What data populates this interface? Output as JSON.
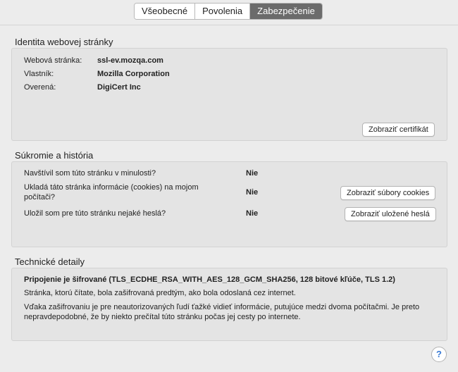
{
  "tabs": [
    {
      "label": "Všeobecné",
      "active": false
    },
    {
      "label": "Povolenia",
      "active": false
    },
    {
      "label": "Zabezpečenie",
      "active": true
    }
  ],
  "identity": {
    "title": "Identita webovej stránky",
    "website_label": "Webová stránka:",
    "website_value": "ssl-ev.mozqa.com",
    "owner_label": "Vlastník:",
    "owner_value": "Mozilla Corporation",
    "verified_label": "Overená:",
    "verified_value": "DigiCert Inc",
    "view_certificate_label": "Zobraziť certifikát"
  },
  "privacy": {
    "title": "Súkromie a história",
    "visited_question": "Navštívil som túto stránku v minulosti?",
    "visited_answer": "Nie",
    "cookies_question_line1": "Ukladá táto stránka informácie (cookies) na mojom",
    "cookies_question_line2": "počítači?",
    "cookies_answer": "Nie",
    "view_cookies_label": "Zobraziť súbory cookies",
    "passwords_question": "Uložil som pre túto stránku nejaké heslá?",
    "passwords_answer": "Nie",
    "view_passwords_label": "Zobraziť uložené heslá"
  },
  "technical": {
    "title": "Technické detaily",
    "connection_line": "Pripojenie je šifrované (TLS_ECDHE_RSA_WITH_AES_128_GCM_SHA256, 128 bitové kľúče, TLS 1.2)",
    "line2": "Stránka, ktorú čítate, bola zašifrovaná predtým, ako bola odoslaná cez internet.",
    "line3a": "Vďaka zašifrovaniu je pre neautorizovaných ľudí ťažké vidieť informácie, putujúce medzi dvoma počítačmi. Je preto",
    "line3b": "nepravdepodobné, že by niekto prečítal túto stránku počas jej cesty po internete."
  },
  "help_label": "?",
  "colors": {
    "active_tab": "#6b6b6b",
    "help": "#3a7bd5",
    "panel": "#e4e4e4"
  }
}
